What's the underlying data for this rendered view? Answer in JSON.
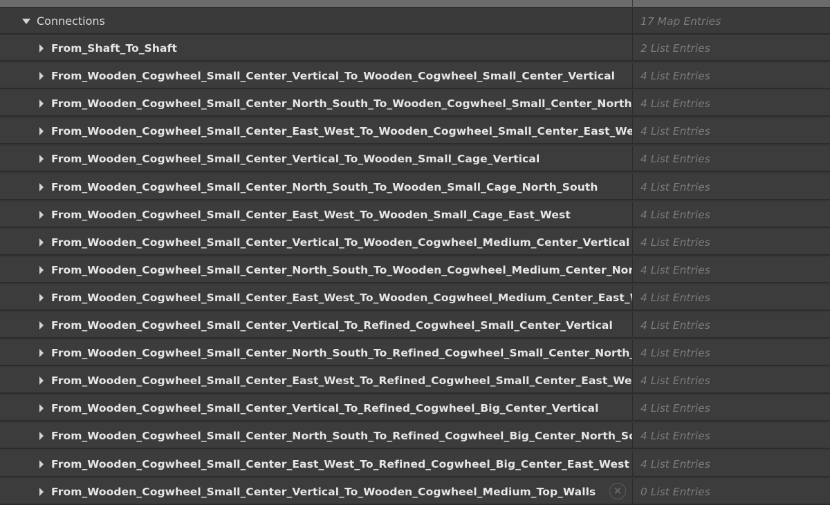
{
  "header": {
    "label": "Connections",
    "value": "17 Map Entries"
  },
  "entries": [
    {
      "label": "From_Shaft_To_Shaft",
      "value": "2 List Entries"
    },
    {
      "label": "From_Wooden_Cogwheel_Small_Center_Vertical_To_Wooden_Cogwheel_Small_Center_Vertical",
      "value": "4 List Entries"
    },
    {
      "label": "From_Wooden_Cogwheel_Small_Center_North_South_To_Wooden_Cogwheel_Small_Center_North_South",
      "value": "4 List Entries"
    },
    {
      "label": "From_Wooden_Cogwheel_Small_Center_East_West_To_Wooden_Cogwheel_Small_Center_East_West",
      "value": "4 List Entries"
    },
    {
      "label": "From_Wooden_Cogwheel_Small_Center_Vertical_To_Wooden_Small_Cage_Vertical",
      "value": "4 List Entries"
    },
    {
      "label": "From_Wooden_Cogwheel_Small_Center_North_South_To_Wooden_Small_Cage_North_South",
      "value": "4 List Entries"
    },
    {
      "label": "From_Wooden_Cogwheel_Small_Center_East_West_To_Wooden_Small_Cage_East_West",
      "value": "4 List Entries"
    },
    {
      "label": "From_Wooden_Cogwheel_Small_Center_Vertical_To_Wooden_Cogwheel_Medium_Center_Vertical",
      "value": "4 List Entries"
    },
    {
      "label": "From_Wooden_Cogwheel_Small_Center_North_South_To_Wooden_Cogwheel_Medium_Center_North_South",
      "value": "4 List Entries"
    },
    {
      "label": "From_Wooden_Cogwheel_Small_Center_East_West_To_Wooden_Cogwheel_Medium_Center_East_West",
      "value": "4 List Entries"
    },
    {
      "label": "From_Wooden_Cogwheel_Small_Center_Vertical_To_Refined_Cogwheel_Small_Center_Vertical",
      "value": "4 List Entries"
    },
    {
      "label": "From_Wooden_Cogwheel_Small_Center_North_South_To_Refined_Cogwheel_Small_Center_North_South",
      "value": "4 List Entries"
    },
    {
      "label": "From_Wooden_Cogwheel_Small_Center_East_West_To_Refined_Cogwheel_Small_Center_East_West",
      "value": "4 List Entries"
    },
    {
      "label": "From_Wooden_Cogwheel_Small_Center_Vertical_To_Refined_Cogwheel_Big_Center_Vertical",
      "value": "4 List Entries"
    },
    {
      "label": "From_Wooden_Cogwheel_Small_Center_North_South_To_Refined_Cogwheel_Big_Center_North_South",
      "value": "4 List Entries"
    },
    {
      "label": "From_Wooden_Cogwheel_Small_Center_East_West_To_Refined_Cogwheel_Big_Center_East_West",
      "value": "4 List Entries"
    },
    {
      "label": "From_Wooden_Cogwheel_Small_Center_Vertical_To_Wooden_Cogwheel_Medium_Top_Walls",
      "value": "0 List Entries"
    }
  ],
  "icons": {
    "expanded": "triangle-down-icon",
    "collapsed": "triangle-right-icon",
    "clear": "close-circle-icon"
  },
  "colors": {
    "background": "#383838",
    "row": "#3c3c3c",
    "separator": "#2c2c2c",
    "text": "#e6e6e6",
    "muted": "#7c7c7c"
  }
}
